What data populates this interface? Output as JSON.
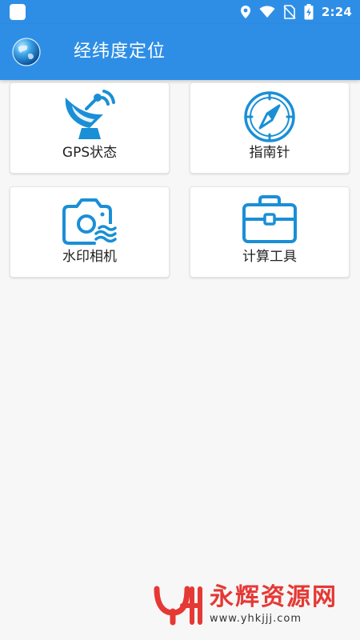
{
  "status_bar": {
    "time": "2:24",
    "icons": [
      "location-icon",
      "wifi-icon",
      "no-sim-icon",
      "battery-charging-icon"
    ]
  },
  "app_bar": {
    "title": "经纬度定位",
    "logo_icon": "globe-icon"
  },
  "tiles": [
    {
      "label": "GPS状态",
      "icon": "satellite-dish-icon"
    },
    {
      "label": "指南针",
      "icon": "compass-icon"
    },
    {
      "label": "水印相机",
      "icon": "camera-icon"
    },
    {
      "label": "计算工具",
      "icon": "toolbox-icon"
    }
  ],
  "watermark": {
    "title": "永辉资源网",
    "url": "www.yhkjjj.com"
  },
  "colors": {
    "primary": "#2e8ee6",
    "icon_blue": "#1a8fd6",
    "watermark_red": "#e53935"
  }
}
